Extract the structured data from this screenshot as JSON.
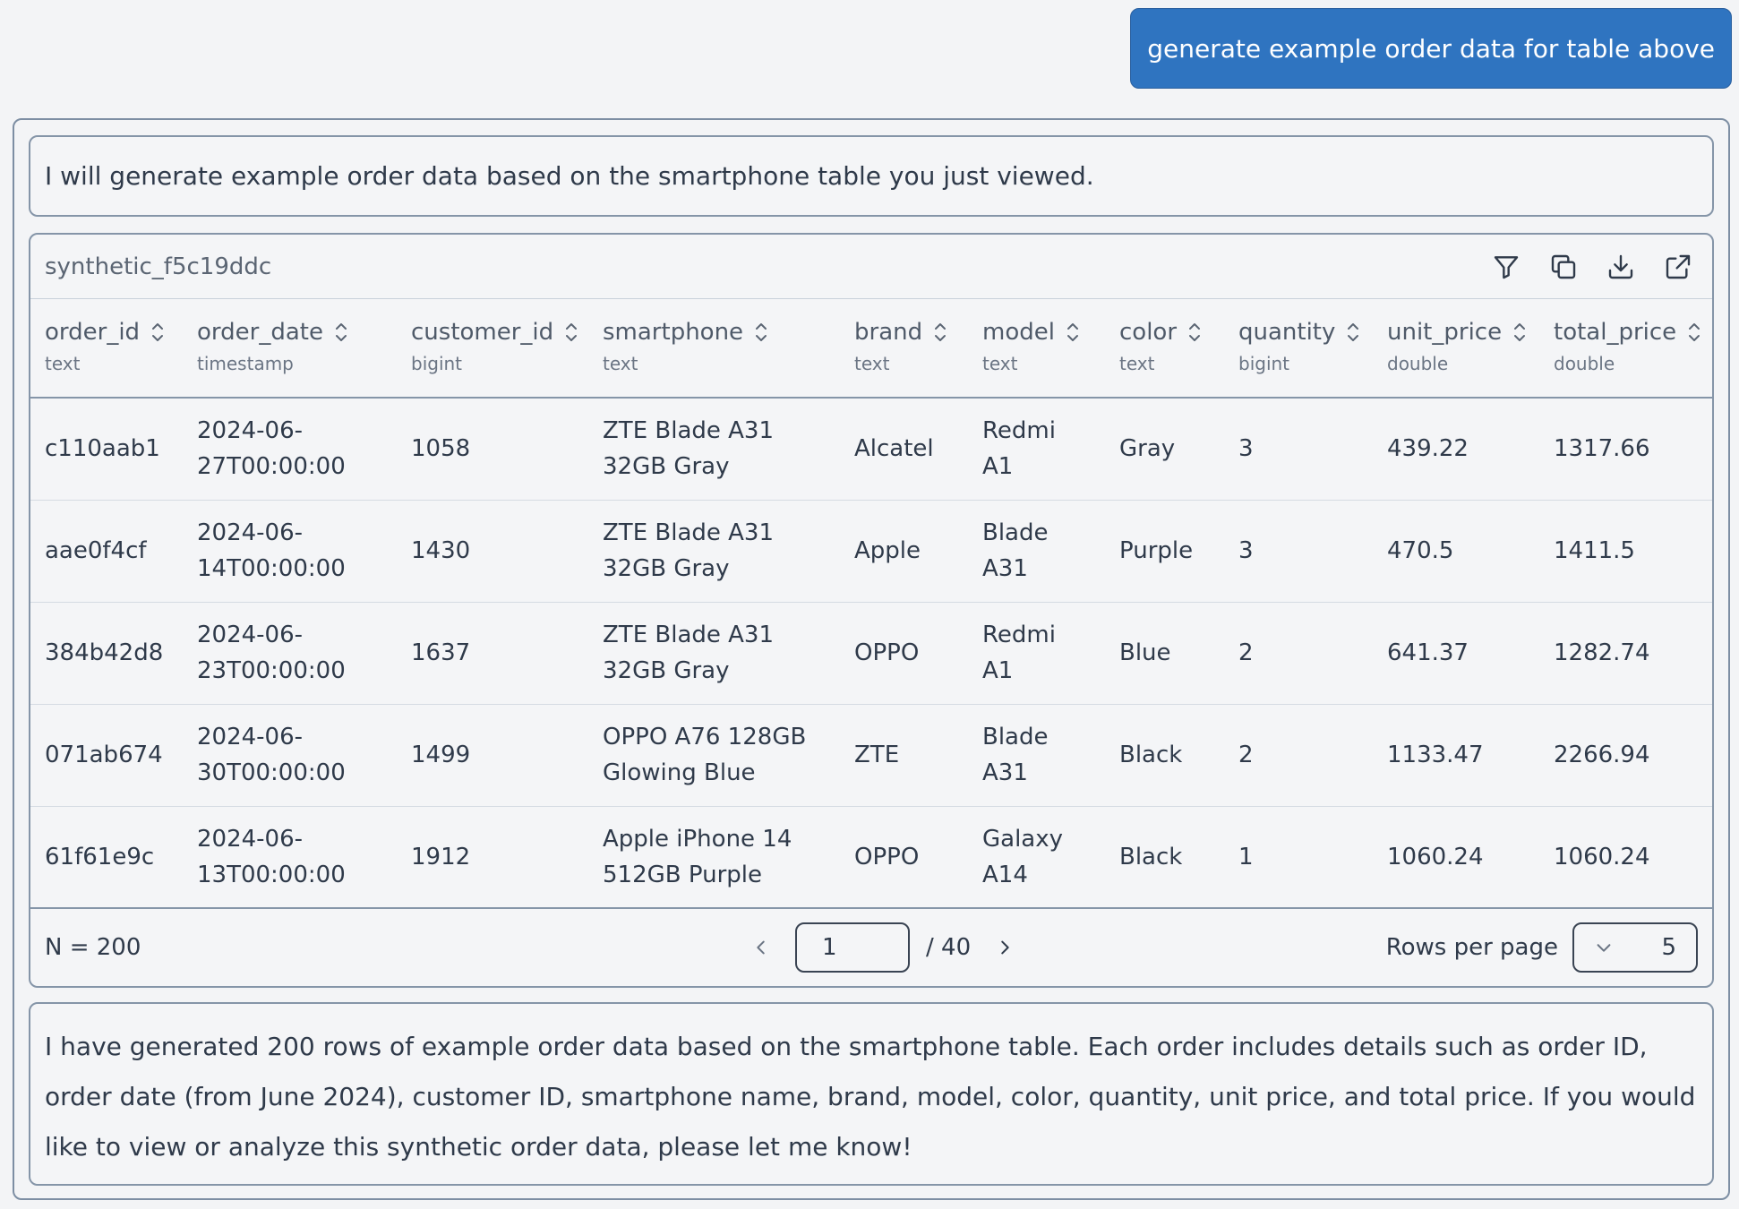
{
  "user_message": "generate example order data for table above",
  "assistant": {
    "intro": "I will generate example order data based on the smartphone table you just viewed.",
    "outro": "I have generated 200 rows of example order data based on the smartphone table. Each order includes details such as order ID, order date (from June 2024), customer ID, smartphone name, brand, model, color, quantity, unit price, and total price. If you would like to view or analyze this synthetic order data, please let me know!"
  },
  "table": {
    "title": "synthetic_f5c19ddc",
    "toolbar_icons": [
      "filter-icon",
      "copy-icon",
      "download-icon",
      "open-external-icon"
    ],
    "columns": [
      {
        "name": "order_id",
        "type": "text"
      },
      {
        "name": "order_date",
        "type": "timestamp"
      },
      {
        "name": "customer_id",
        "type": "bigint"
      },
      {
        "name": "smartphone",
        "type": "text"
      },
      {
        "name": "brand",
        "type": "text"
      },
      {
        "name": "model",
        "type": "text"
      },
      {
        "name": "color",
        "type": "text"
      },
      {
        "name": "quantity",
        "type": "bigint"
      },
      {
        "name": "unit_price",
        "type": "double"
      },
      {
        "name": "total_price",
        "type": "double"
      }
    ],
    "rows": [
      [
        "c110aab1",
        "2024-06-27T00:00:00",
        "1058",
        "ZTE Blade A31 32GB Gray",
        "Alcatel",
        "Redmi A1",
        "Gray",
        "3",
        "439.22",
        "1317.66"
      ],
      [
        "aae0f4cf",
        "2024-06-14T00:00:00",
        "1430",
        "ZTE Blade A31 32GB Gray",
        "Apple",
        "Blade A31",
        "Purple",
        "3",
        "470.5",
        "1411.5"
      ],
      [
        "384b42d8",
        "2024-06-23T00:00:00",
        "1637",
        "ZTE Blade A31 32GB Gray",
        "OPPO",
        "Redmi A1",
        "Blue",
        "2",
        "641.37",
        "1282.74"
      ],
      [
        "071ab674",
        "2024-06-30T00:00:00",
        "1499",
        "OPPO A76 128GB Glowing Blue",
        "ZTE",
        "Blade A31",
        "Black",
        "2",
        "1133.47",
        "2266.94"
      ],
      [
        "61f61e9c",
        "2024-06-13T00:00:00",
        "1912",
        "Apple iPhone 14 512GB Purple",
        "OPPO",
        "Galaxy A14",
        "Black",
        "1",
        "1060.24",
        "1060.24"
      ]
    ],
    "footer": {
      "row_count": "N = 200",
      "current_page": "1",
      "total_pages": "/ 40",
      "rows_per_page_label": "Rows per page",
      "rows_per_page_value": "5"
    }
  },
  "colors": {
    "user_bubble": "#2f74c0",
    "border": "#8595a8",
    "background": "#f3f4f6"
  }
}
